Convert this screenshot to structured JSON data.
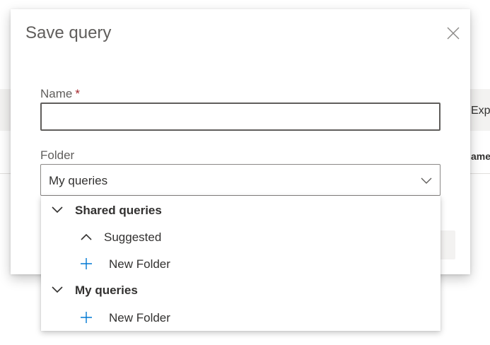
{
  "background": {
    "export_fragment": "Exp",
    "name_fragment": "ame"
  },
  "dialog": {
    "title": "Save query",
    "close_icon": "close-icon",
    "name_label": "Name",
    "required_marker": "*",
    "name_value": "",
    "folder_label": "Folder",
    "folder_selected": "My queries",
    "folder_chevron_icon": "chevron-down-icon"
  },
  "dropdown": {
    "items": [
      {
        "label": "Shared queries",
        "icon": "chevron-down-icon",
        "level": 0
      },
      {
        "label": "Suggested",
        "icon": "chevron-up-icon",
        "level": 1
      },
      {
        "label": "New Folder",
        "icon": "add-icon",
        "level": 1
      },
      {
        "label": "My queries",
        "icon": "chevron-down-icon",
        "level": 0
      },
      {
        "label": "New Folder",
        "icon": "add-icon",
        "level": 1
      }
    ]
  },
  "colors": {
    "accent_blue": "#0078d4",
    "required_red": "#a4262c",
    "text": "#323130",
    "muted_text": "#605e5c"
  }
}
